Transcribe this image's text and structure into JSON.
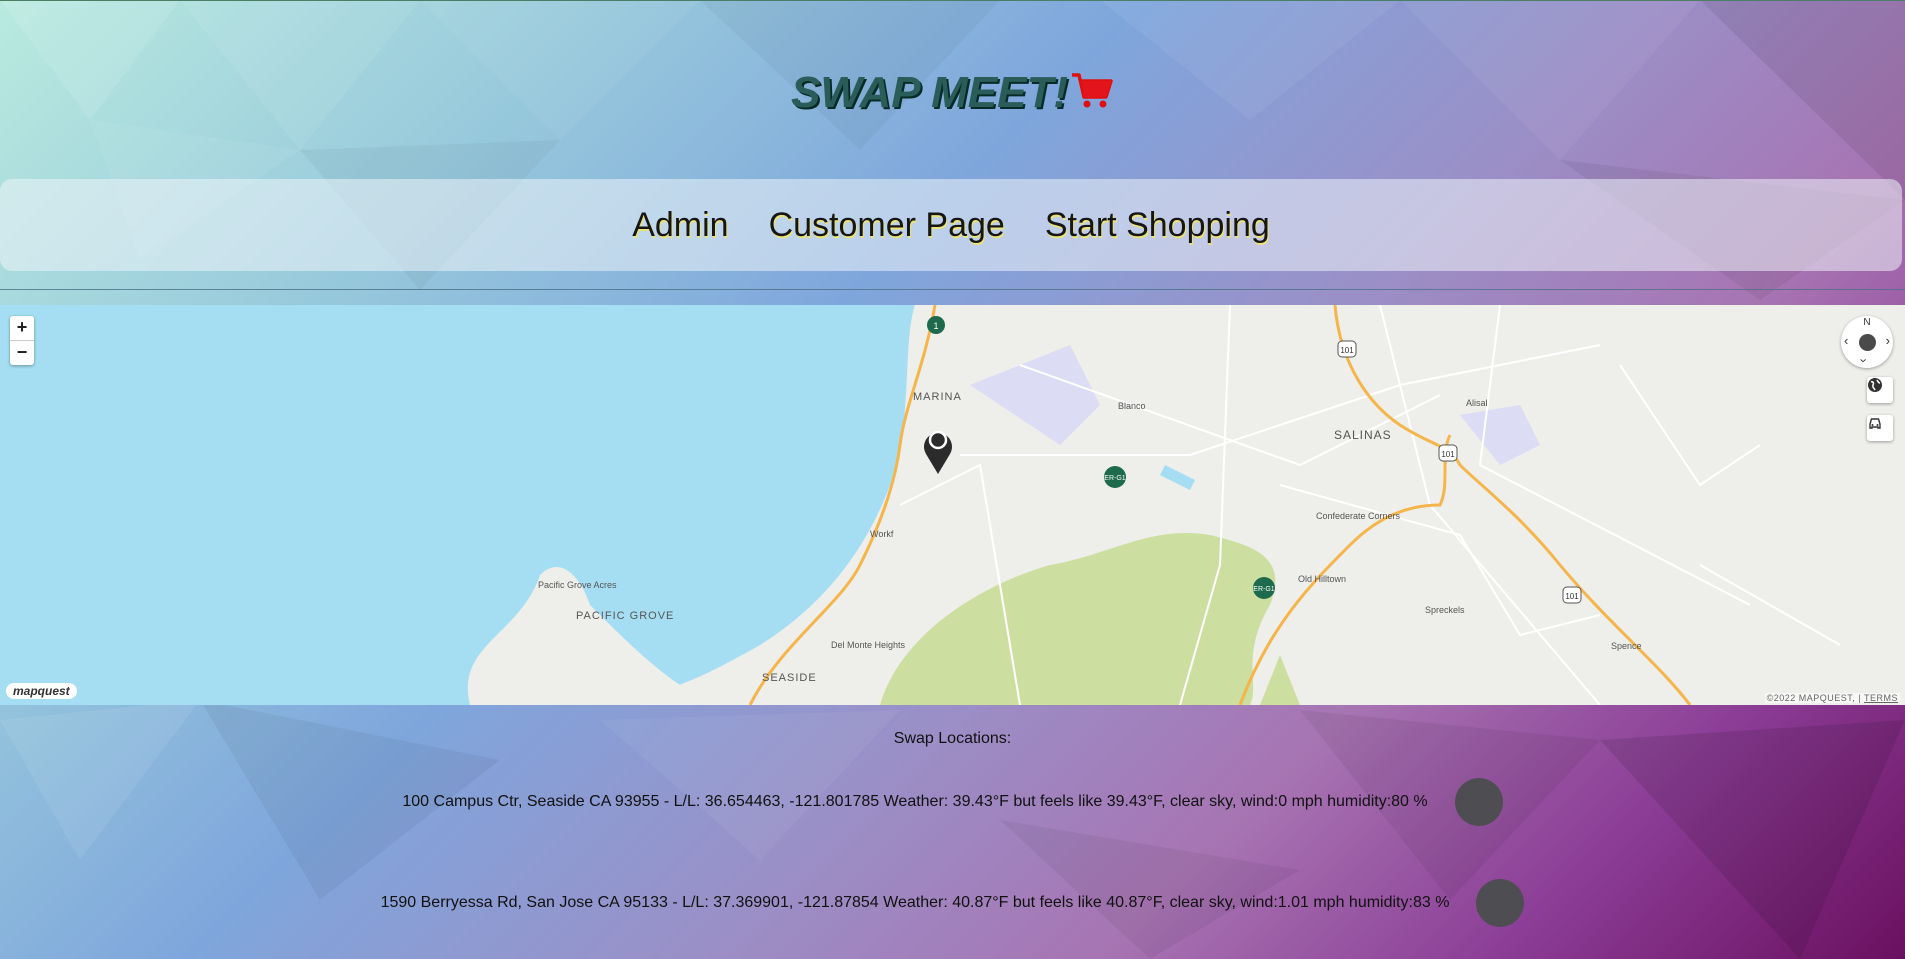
{
  "header": {
    "title": "SWAP MEET!",
    "cart_icon": "shopping-cart-icon"
  },
  "nav": {
    "items": [
      {
        "label": "Admin"
      },
      {
        "label": "Customer Page"
      },
      {
        "label": "Start Shopping"
      }
    ]
  },
  "map": {
    "zoom_in": "+",
    "zoom_out": "−",
    "compass_north": "N",
    "logo": "mapquest",
    "attribution": "©2022 MAPQUEST,",
    "terms": "TERMS",
    "labels": {
      "marina": "MARINA",
      "blanco": "Blanco",
      "salinas": "SALINAS",
      "alisal": "Alisal",
      "confederate_corners": "Confederate Corners",
      "old_hilltown": "Old Hilltown",
      "spreckels": "Spreckels",
      "spence": "Spence",
      "workf": "Workf",
      "pacific_grove_acres": "Pacific Grove Acres",
      "pacific_grove": "PACIFIC GROVE",
      "del_monte_heights": "Del Monte Heights",
      "seaside": "SEASIDE",
      "shield_1": "1",
      "shield_101": "101",
      "shield_g1": "ER-G1"
    },
    "colors": {
      "water": "#a5def3",
      "land": "#eeeeea",
      "park": "#cddfa0",
      "highway": "#f5b54a",
      "restricted": "#dcdcf5"
    }
  },
  "swap": {
    "heading": "Swap Locations:",
    "locations": [
      {
        "text": "100 Campus Ctr, Seaside CA 93955 - L/L: 36.654463, -121.801785 Weather: 39.43°F but feels like 39.43°F, clear sky, wind:0 mph humidity:80 %"
      },
      {
        "text": "1590 Berryessa Rd, San Jose CA 95133 - L/L: 37.369901, -121.87854 Weather: 40.87°F but feels like 40.87°F, clear sky, wind:1.01 mph humidity:83 %"
      }
    ]
  }
}
